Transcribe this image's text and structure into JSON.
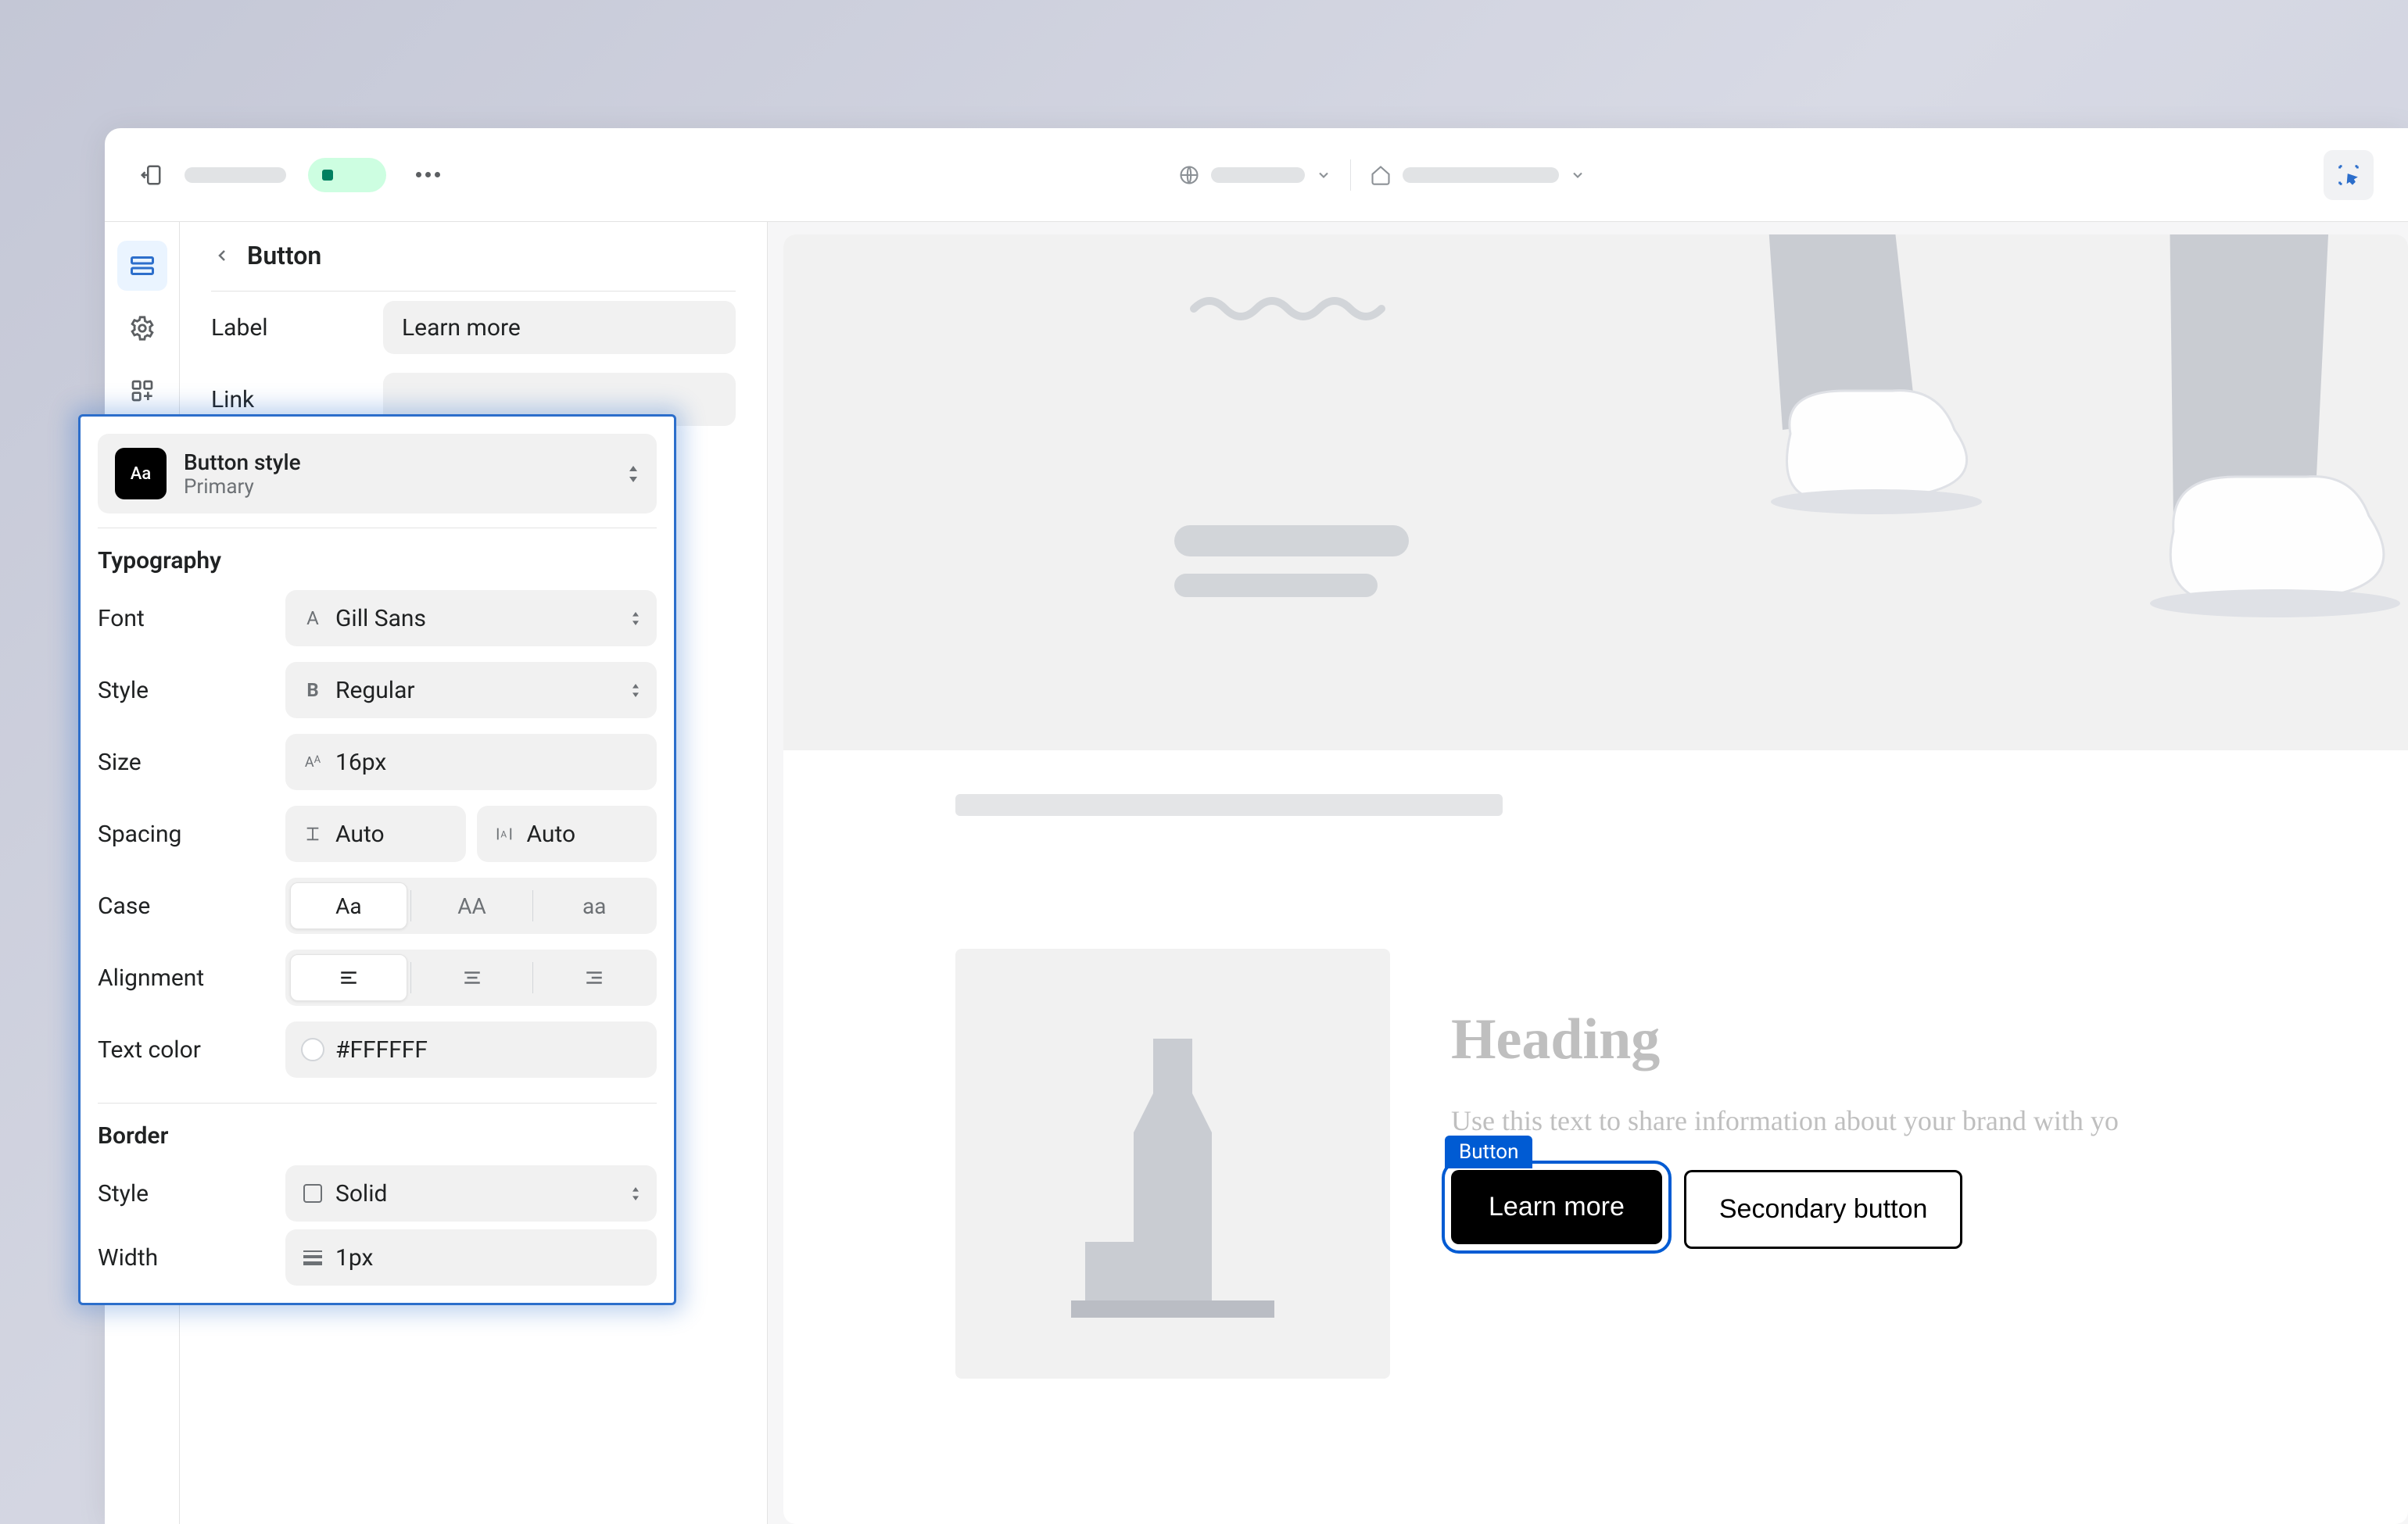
{
  "sidePanel": {
    "title": "Button",
    "labelField": {
      "label": "Label",
      "value": "Learn more"
    },
    "linkField": {
      "label": "Link"
    }
  },
  "stylePanel": {
    "styleCard": {
      "title": "Button style",
      "subtitle": "Primary",
      "swatchText": "Aa"
    },
    "typography": {
      "heading": "Typography",
      "font": {
        "label": "Font",
        "value": "Gill Sans"
      },
      "style": {
        "label": "Style",
        "value": "Regular"
      },
      "size": {
        "label": "Size",
        "value": "16px"
      },
      "spacing": {
        "label": "Spacing",
        "lineHeight": "Auto",
        "letterSpacing": "Auto"
      },
      "case": {
        "label": "Case",
        "options": [
          "Aa",
          "AA",
          "aa"
        ],
        "active": 0
      },
      "alignment": {
        "label": "Alignment",
        "active": 0
      },
      "textColor": {
        "label": "Text color",
        "value": "#FFFFFF"
      }
    },
    "border": {
      "heading": "Border",
      "style": {
        "label": "Style",
        "value": "Solid"
      },
      "width": {
        "label": "Width",
        "value": "1px"
      }
    }
  },
  "canvas": {
    "selectionTag": "Button",
    "heading": "Heading",
    "body": "Use this text to share information about your brand with yo",
    "primaryButton": "Learn more",
    "secondaryButton": "Secondary button"
  }
}
